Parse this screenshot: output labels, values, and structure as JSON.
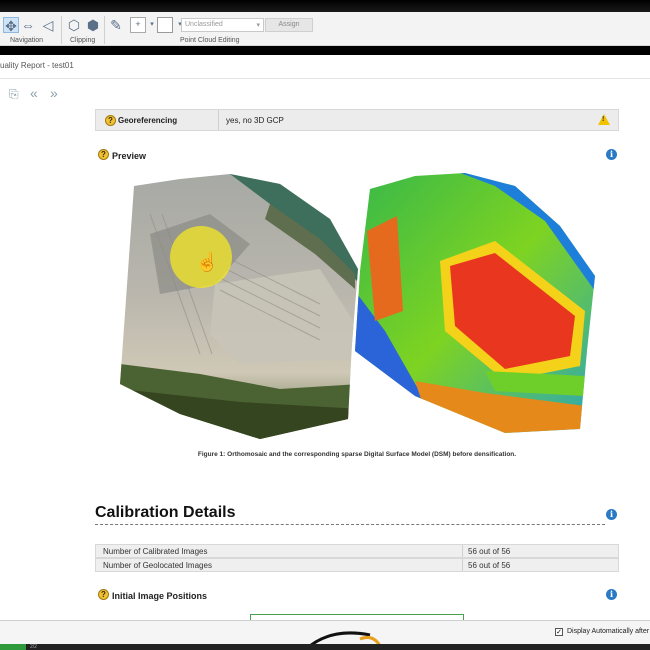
{
  "ribbon": {
    "groups": {
      "navigation": "Navigation",
      "clipping": "Clipping",
      "point_cloud": "Point Cloud Editing"
    },
    "class_combo": "Unclassified",
    "assign_button": "Assign"
  },
  "window": {
    "title": "uality Report - test01"
  },
  "report": {
    "georef": {
      "label": "Georeferencing",
      "value": "yes, no 3D GCP"
    },
    "preview": {
      "title": "Preview",
      "caption": "Figure 1: Orthomosaic and the corresponding sparse Digital Surface Model (DSM) before densification."
    },
    "calibration": {
      "title": "Calibration Details",
      "rows": [
        {
          "label": "Number of Calibrated Images",
          "value": "56 out of 56"
        },
        {
          "label": "Number of Geolocated Images",
          "value": "56 out of 56"
        }
      ]
    },
    "initial_positions": {
      "title": "Initial Image Positions"
    }
  },
  "status": {
    "display_label": "Display Automatically after",
    "display_checked": true,
    "page_count": "2/2"
  },
  "colors": {
    "accent_blue": "#2a7bc4",
    "help_yellow": "#f0c233",
    "warning": "#f2c200",
    "cursor_highlight": "#f0e428"
  }
}
